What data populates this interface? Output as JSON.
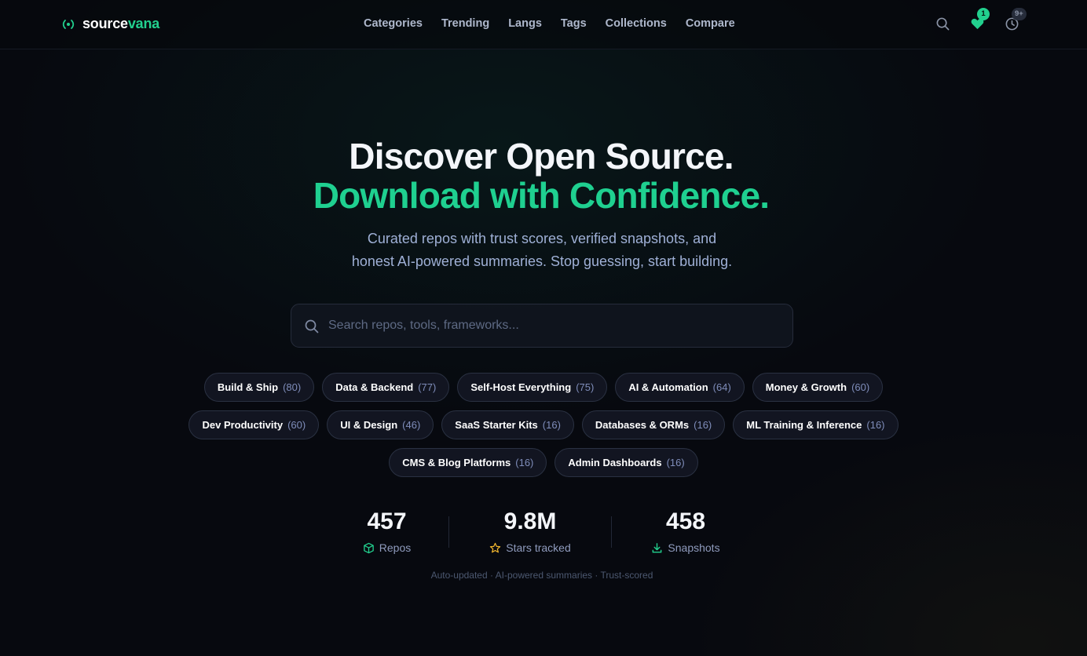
{
  "brand": {
    "part1": "source",
    "part2": "vana",
    "accent_color": "#22d08e"
  },
  "nav": {
    "links": [
      "Categories",
      "Trending",
      "Langs",
      "Tags",
      "Collections",
      "Compare"
    ],
    "favorites_badge": "1",
    "history_badge": "9+"
  },
  "hero": {
    "title_line1": "Discover Open Source.",
    "title_line2": "Download with Confidence.",
    "subtitle_line1": "Curated repos with trust scores, verified snapshots, and",
    "subtitle_line2": "honest AI-powered summaries. Stop guessing, start building."
  },
  "search": {
    "placeholder": "Search repos, tools, frameworks...",
    "value": ""
  },
  "categories": [
    [
      {
        "label": "Build & Ship",
        "count": "(80)"
      },
      {
        "label": "Data & Backend",
        "count": "(77)"
      },
      {
        "label": "Self-Host Everything",
        "count": "(75)"
      },
      {
        "label": "AI & Automation",
        "count": "(64)"
      },
      {
        "label": "Money & Growth",
        "count": "(60)"
      }
    ],
    [
      {
        "label": "Dev Productivity",
        "count": "(60)"
      },
      {
        "label": "UI & Design",
        "count": "(46)"
      },
      {
        "label": "SaaS Starter Kits",
        "count": "(16)"
      },
      {
        "label": "Databases & ORMs",
        "count": "(16)"
      },
      {
        "label": "ML Training & Inference",
        "count": "(16)"
      }
    ],
    [
      {
        "label": "CMS & Blog Platforms",
        "count": "(16)"
      },
      {
        "label": "Admin Dashboards",
        "count": "(16)"
      }
    ]
  ],
  "stats": [
    {
      "value": "457",
      "label": "Repos",
      "icon": "cube-icon",
      "color": "#22d08e"
    },
    {
      "value": "9.8M",
      "label": "Stars tracked",
      "icon": "star-icon",
      "color": "#f5b82e"
    },
    {
      "value": "458",
      "label": "Snapshots",
      "icon": "download-icon",
      "color": "#22d08e"
    }
  ],
  "footnote": "Auto-updated · AI-powered summaries · Trust-scored"
}
